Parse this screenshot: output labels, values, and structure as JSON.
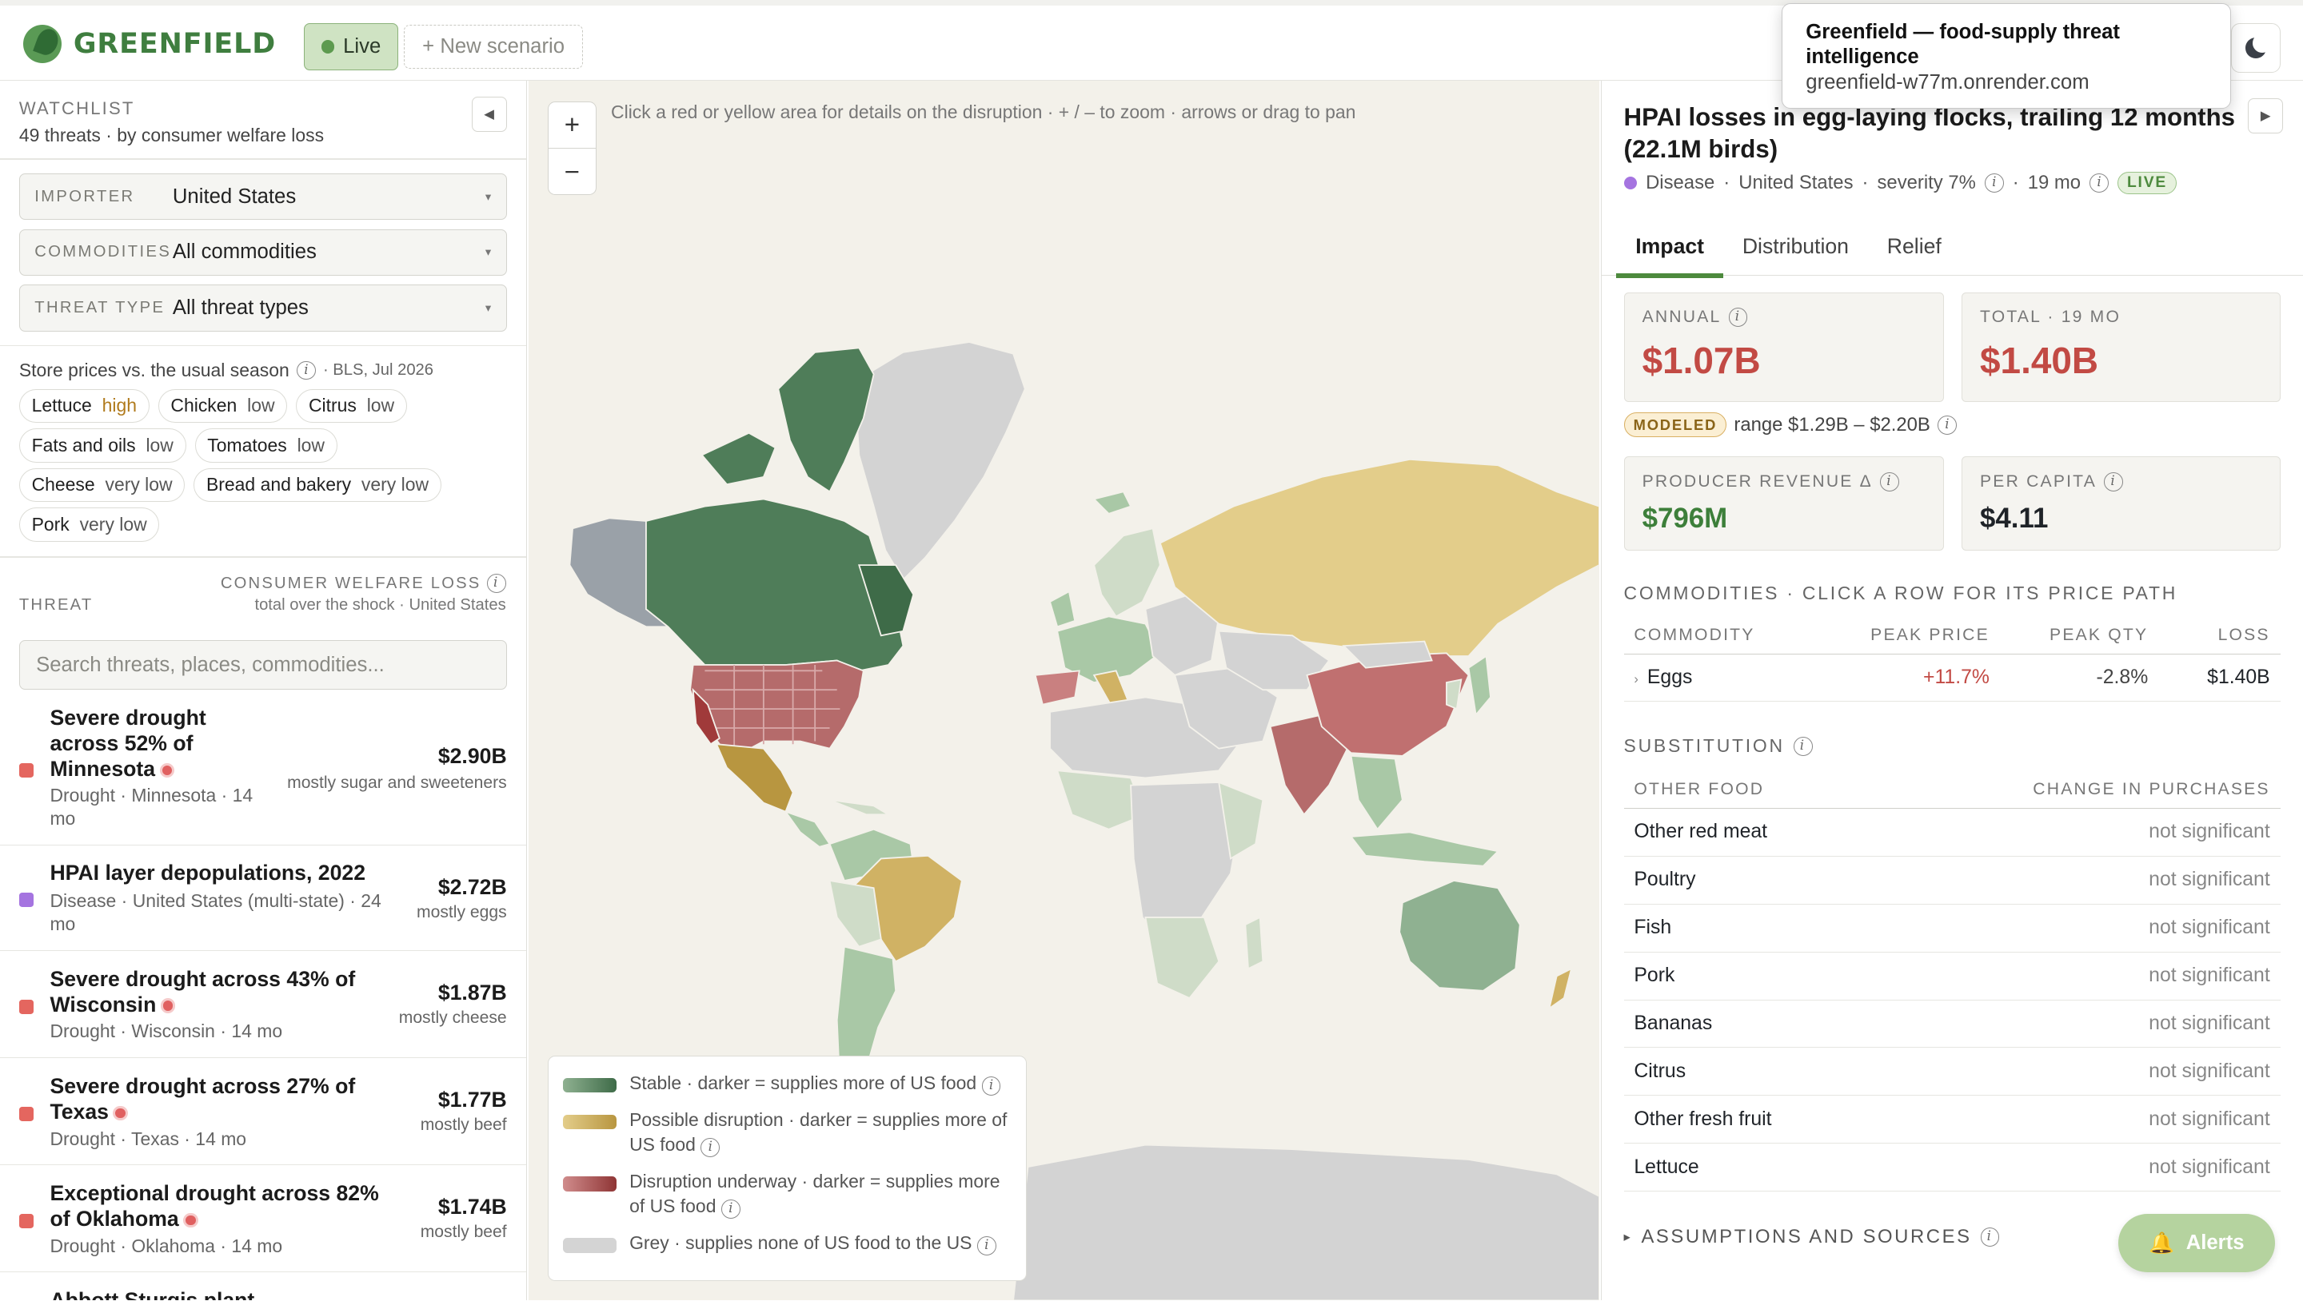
{
  "app": {
    "title": "GREENFIELD",
    "live_label": "Live",
    "new_scenario_label": "+ New scenario",
    "tooltip_title": "Greenfield — food-supply threat intelligence",
    "tooltip_url": "greenfield-w77m.onrender.com"
  },
  "watchlist": {
    "title": "WATCHLIST",
    "subtitle": "49 threats · by consumer welfare loss",
    "filters": [
      {
        "label": "IMPORTER",
        "value": "United States"
      },
      {
        "label": "COMMODITIES",
        "value": "All commodities"
      },
      {
        "label": "THREAT TYPE",
        "value": "All threat types"
      }
    ],
    "prices_title": "Store prices vs. the usual season",
    "prices_source": "· BLS, Jul 2026",
    "prices": [
      {
        "name": "Lettuce",
        "level": "high"
      },
      {
        "name": "Chicken",
        "level": "low"
      },
      {
        "name": "Citrus",
        "level": "low"
      },
      {
        "name": "Fats and oils",
        "level": "low"
      },
      {
        "name": "Tomatoes",
        "level": "low"
      },
      {
        "name": "Cheese",
        "level": "very low"
      },
      {
        "name": "Bread and bakery",
        "level": "very low"
      },
      {
        "name": "Pork",
        "level": "very low"
      }
    ],
    "threat_header": "THREAT",
    "cwl_header": "CONSUMER WELFARE LOSS",
    "cwl_sub": "total over the shock · United States",
    "search_placeholder": "Search threats, places, commodities...",
    "threats": [
      {
        "name": "Severe drought across 52% of Minnesota",
        "meta": "Drought · Minnesota · 14 mo",
        "value": "$2.90B",
        "mostly": "mostly sugar and sweeteners",
        "color": "#e4665f",
        "live": true
      },
      {
        "name": "HPAI layer depopulations, 2022",
        "meta": "Disease · United States (multi-state) · 24 mo",
        "value": "$2.72B",
        "mostly": "mostly eggs",
        "color": "#a574e0",
        "live": false
      },
      {
        "name": "Severe drought across 43% of Wisconsin",
        "meta": "Drought · Wisconsin · 14 mo",
        "value": "$1.87B",
        "mostly": "mostly cheese",
        "color": "#e4665f",
        "live": true
      },
      {
        "name": "Severe drought across 27% of Texas",
        "meta": "Drought · Texas · 14 mo",
        "value": "$1.77B",
        "mostly": "mostly beef",
        "color": "#e4665f",
        "live": true
      },
      {
        "name": "Exceptional drought across 82% of Oklahoma",
        "meta": "Drought · Oklahoma · 14 mo",
        "value": "$1.74B",
        "mostly": "mostly beef",
        "color": "#e4665f",
        "live": true
      },
      {
        "name": "Abbott Sturgis plant",
        "meta": "",
        "value": "",
        "mostly": "",
        "color": "#e4665f",
        "live": false
      }
    ]
  },
  "map": {
    "hint": "Click a red or yellow area for details on the disruption · + / – to zoom · arrows or drag to pan",
    "zoom_in": "+",
    "zoom_out": "−",
    "legend": [
      {
        "text": "Stable · darker = supplies more of US food",
        "color": "#5a8a63"
      },
      {
        "text": "Possible disruption · darker = supplies more of US food",
        "color": "#d2b66a"
      },
      {
        "text": "Disruption underway · darker = supplies more of US food",
        "color": "#b66565"
      },
      {
        "text": "Grey · supplies none of US food to the US",
        "color": "#d4d4d4"
      }
    ]
  },
  "detail": {
    "title": "HPAI losses in egg-laying flocks, trailing 12 months (22.1M birds)",
    "category": "Disease",
    "place": "United States",
    "severity": "severity 7%",
    "duration": "19 mo",
    "live_badge": "LIVE",
    "tabs": [
      "Impact",
      "Distribution",
      "Relief"
    ],
    "annual_label": "ANNUAL",
    "annual_value": "$1.07B",
    "total_label": "TOTAL · 19 MO",
    "total_value": "$1.40B",
    "modeled_badge": "MODELED",
    "range_text": "range $1.29B – $2.20B",
    "producer_label": "PRODUCER REVENUE Δ",
    "producer_value": "$796M",
    "percap_label": "PER CAPITA",
    "percap_value": "$4.11",
    "commodities_title": "COMMODITIES · CLICK A ROW FOR ITS PRICE PATH",
    "commodity_headers": [
      "COMMODITY",
      "PEAK PRICE",
      "PEAK QTY",
      "LOSS"
    ],
    "commodity_rows": [
      {
        "name": "Eggs",
        "peak_price": "+11.7%",
        "peak_qty": "-2.8%",
        "loss": "$1.40B"
      }
    ],
    "substitution_title": "SUBSTITUTION",
    "substitution_headers": [
      "OTHER FOOD",
      "CHANGE IN PURCHASES"
    ],
    "substitution_rows": [
      {
        "food": "Other red meat",
        "change": "not significant"
      },
      {
        "food": "Poultry",
        "change": "not significant"
      },
      {
        "food": "Fish",
        "change": "not significant"
      },
      {
        "food": "Pork",
        "change": "not significant"
      },
      {
        "food": "Bananas",
        "change": "not significant"
      },
      {
        "food": "Citrus",
        "change": "not significant"
      },
      {
        "food": "Other fresh fruit",
        "change": "not significant"
      },
      {
        "food": "Lettuce",
        "change": "not significant"
      }
    ],
    "assumptions_label": "ASSUMPTIONS AND SOURCES",
    "alerts_label": "Alerts"
  }
}
